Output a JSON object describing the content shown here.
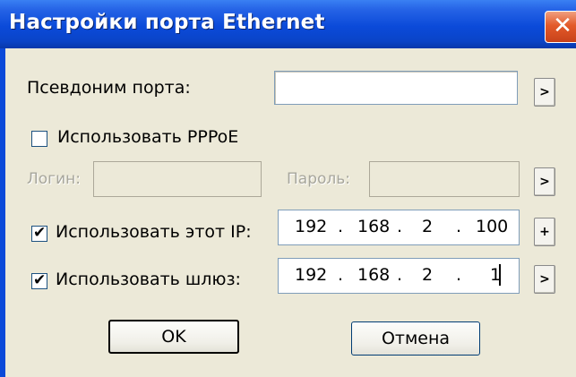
{
  "window": {
    "title": "Настройки порта Ethernet",
    "close_glyph": "✕"
  },
  "port_alias": {
    "label": "Псевдоним порта:",
    "value": "",
    "button_label": ">"
  },
  "pppoe": {
    "label": "Использовать PPPoE",
    "checked": false
  },
  "login": {
    "label": "Логин:",
    "value": ""
  },
  "password": {
    "label": "Пароль:",
    "value": "",
    "button_label": ">"
  },
  "ip": {
    "label": "Использовать этот IP:",
    "checked": true,
    "check_glyph": "✔",
    "octets": [
      "192",
      "168",
      "2",
      "100"
    ],
    "button_label": "+"
  },
  "gateway": {
    "label": "Использовать шлюз:",
    "checked": true,
    "check_glyph": "✔",
    "octets": [
      "192",
      "168",
      "2",
      "1"
    ],
    "button_label": ">"
  },
  "buttons": {
    "ok": "OK",
    "cancel": "Отмена"
  },
  "colors": {
    "titlebar": "#0b4ad9",
    "dialog_bg": "#ece9d8",
    "close_button": "#e35a2a"
  }
}
